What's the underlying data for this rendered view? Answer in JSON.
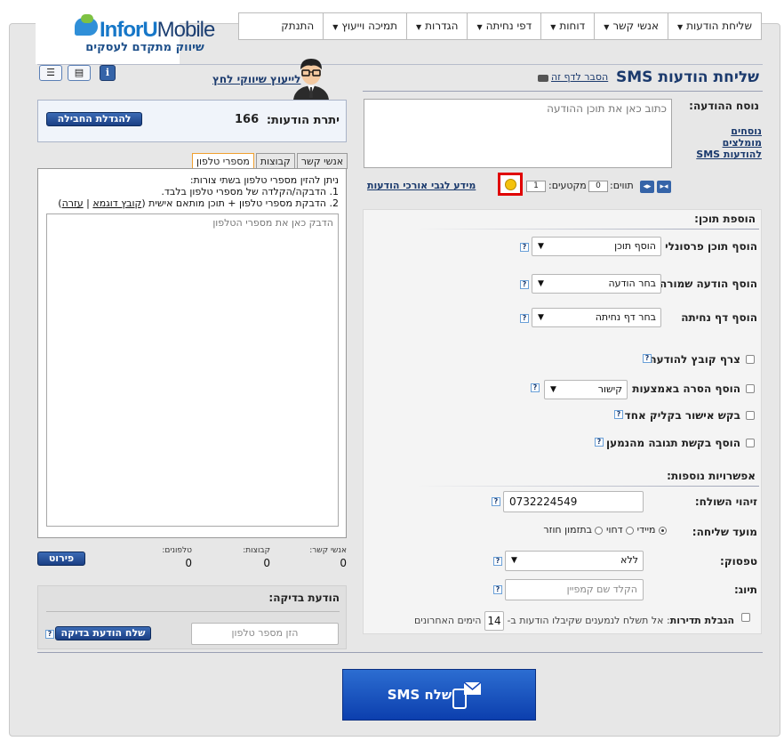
{
  "brand": {
    "name_part1": "InforU",
    "name_part2": "Mobile",
    "tagline": "שיווק מתקדם לעסקים"
  },
  "nav": {
    "items": [
      {
        "label": "שליחת הודעות",
        "dropdown": true
      },
      {
        "label": "אנשי קשר",
        "dropdown": true
      },
      {
        "label": "דוחות",
        "dropdown": true
      },
      {
        "label": "דפי נחיתה",
        "dropdown": true
      },
      {
        "label": "הגדרות",
        "dropdown": true
      },
      {
        "label": "תמיכה וייעוץ",
        "dropdown": true
      },
      {
        "label": "התנתק",
        "dropdown": false
      }
    ]
  },
  "page": {
    "title": "שליחת הודעות SMS",
    "help_link": "הסבר לדף זה",
    "consult_link": "לייעוץ שיווקי לחץ"
  },
  "message": {
    "label": "נוסח ההודעה:",
    "placeholder": "כתוב כאן את תוכן ההודעה",
    "recommended_link_1": "נוסחים מומלצים",
    "recommended_link_2": "להודעות SMS",
    "chars_label": "תווים:",
    "chars_value": "0",
    "segments_label": "מקטעים:",
    "segments_value": "1",
    "long_msgs_link": "מידע לגבי אורכי הודעות"
  },
  "add_content": {
    "title": "הוספת תוכן:",
    "personal": {
      "label": "הוסף תוכן פרסונלי",
      "value": "הוסף תוכן"
    },
    "saved": {
      "label": "הוסף הודעה שמורה",
      "value": "בחר הודעה"
    },
    "landing": {
      "label": "הוסף דף נחיתה",
      "value": "בחר דף נחיתה"
    },
    "attach_file": "צרף קובץ להודעה",
    "unsubscribe": {
      "label": "הוסף הסרה באמצעות",
      "value": "קישור"
    },
    "one_click": "בקש אישור בקליק אחד",
    "reply": "הוסף בקשת תגובה מהנמען"
  },
  "extra": {
    "title": "אפשרויות נוספות:",
    "sender_label": "זיהוי השולח:",
    "sender_value": "0732224549",
    "timing_label": "מועד שליחה:",
    "timing_options": [
      "מיידי",
      "דחוי",
      "בתזמון חוזר"
    ],
    "template_label": "טפסוק:",
    "template_value": "ללא",
    "tag_label": "תיוג:",
    "tag_placeholder": "הקלד שם קמפיין",
    "freq_label": "הגבלת תדירות",
    "freq_text": ": אל תשלח לנמענים שקיבלו הודעות ב-",
    "freq_days": "14",
    "freq_suffix": "הימים האחרונים"
  },
  "credit": {
    "label": "יתרת הודעות:",
    "value": "166",
    "button": "להגדלת החבילה"
  },
  "recipients": {
    "tabs": [
      "אנשי קשר",
      "קבוצות",
      "מספרי טלפון"
    ],
    "active_tab": "מספרי טלפון",
    "instructions": "ניתן להזין מספרי טלפון בשתי צורות:",
    "option1": "1. הדבקה/הקלדה של מספרי טלפון בלבד.",
    "option2_prefix": "2. הדבקת מספרי טלפון + תוכן מותאם אישית (",
    "sample_link": "קובץ דוגמא",
    "separator": " | ",
    "help_link": "עזרה",
    "option2_suffix": ")",
    "placeholder": "הדבק כאן את מספרי הטלפון"
  },
  "summary": {
    "contacts_label": "אנשי קשר:",
    "contacts_value": "0",
    "groups_label": "קבוצות:",
    "groups_value": "0",
    "phones_label": "טלפונים:",
    "phones_value": "0",
    "detail_button": "פירוט"
  },
  "test_message": {
    "title": "הודעת בדיקה:",
    "phone_placeholder": "הזן מספר טלפון",
    "send_button": "שלח הודעת בדיקה"
  },
  "send": {
    "label": "שלח SMS"
  },
  "colors": {
    "brand_blue": "#1b3a6d",
    "accent_red": "#e00000",
    "send_blue": "#1547b8"
  }
}
